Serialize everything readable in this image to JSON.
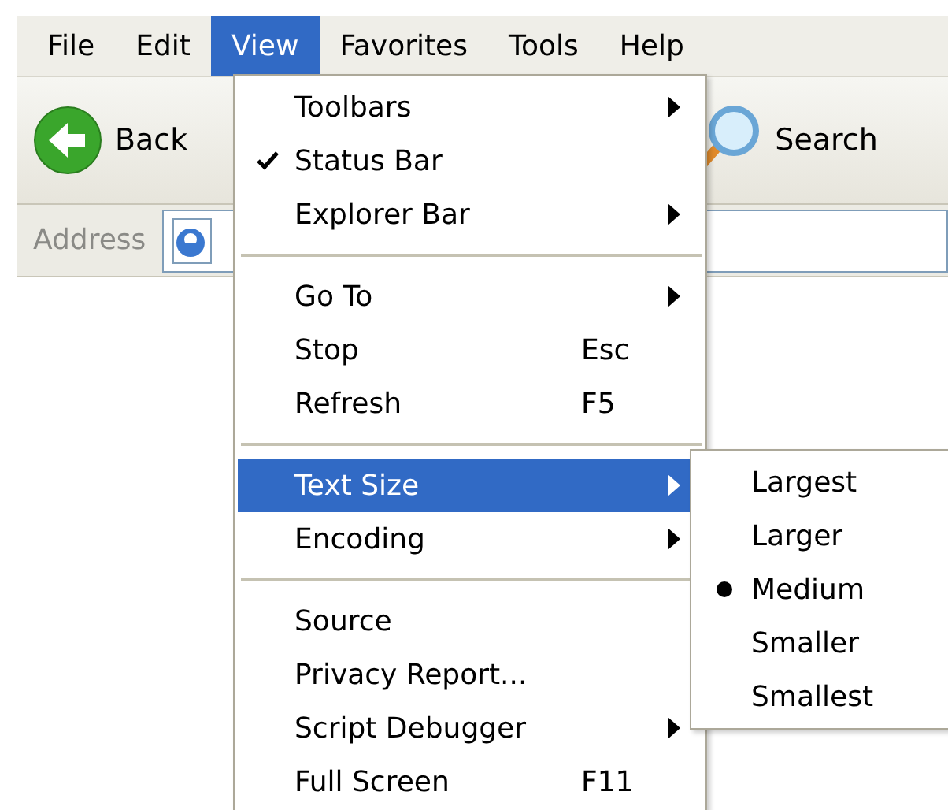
{
  "menu_bar": [
    {
      "label": "File",
      "selected": false
    },
    {
      "label": "Edit",
      "selected": false
    },
    {
      "label": "View",
      "selected": true
    },
    {
      "label": "Favorites",
      "selected": false
    },
    {
      "label": "Tools",
      "selected": false
    },
    {
      "label": "Help",
      "selected": false
    }
  ],
  "toolbar": {
    "back_button": {
      "label": "Back"
    },
    "search_button": {
      "label": "Search"
    }
  },
  "address_bar": {
    "label": "Address"
  },
  "view_menu": [
    {
      "kind": "item",
      "label": "Toolbars",
      "checked": false,
      "submenu": true,
      "selected": false
    },
    {
      "kind": "item",
      "label": "Status Bar",
      "checked": true,
      "submenu": false,
      "selected": false
    },
    {
      "kind": "item",
      "label": "Explorer Bar",
      "checked": false,
      "submenu": true,
      "selected": false
    },
    {
      "kind": "separator"
    },
    {
      "kind": "item",
      "label": "Go To",
      "checked": false,
      "submenu": true,
      "selected": false
    },
    {
      "kind": "item",
      "label": "Stop",
      "shortcut": "Esc",
      "checked": false,
      "submenu": false,
      "selected": false
    },
    {
      "kind": "item",
      "label": "Refresh",
      "shortcut": "F5",
      "checked": false,
      "submenu": false,
      "selected": false
    },
    {
      "kind": "separator"
    },
    {
      "kind": "item",
      "label": "Text Size",
      "checked": false,
      "submenu": true,
      "selected": true
    },
    {
      "kind": "item",
      "label": "Encoding",
      "checked": false,
      "submenu": true,
      "selected": false
    },
    {
      "kind": "separator"
    },
    {
      "kind": "item",
      "label": "Source",
      "checked": false,
      "submenu": false,
      "selected": false
    },
    {
      "kind": "item",
      "label": "Privacy Report...",
      "checked": false,
      "submenu": false,
      "selected": false
    },
    {
      "kind": "item",
      "label": "Script Debugger",
      "checked": false,
      "submenu": true,
      "selected": false
    },
    {
      "kind": "item",
      "label": "Full Screen",
      "shortcut": "F11",
      "checked": false,
      "submenu": false,
      "selected": false
    }
  ],
  "text_size_menu": [
    {
      "label": "Largest",
      "selected": false
    },
    {
      "label": "Larger",
      "selected": false
    },
    {
      "label": "Medium",
      "selected": true
    },
    {
      "label": "Smaller",
      "selected": false
    },
    {
      "label": "Smallest",
      "selected": false
    }
  ]
}
